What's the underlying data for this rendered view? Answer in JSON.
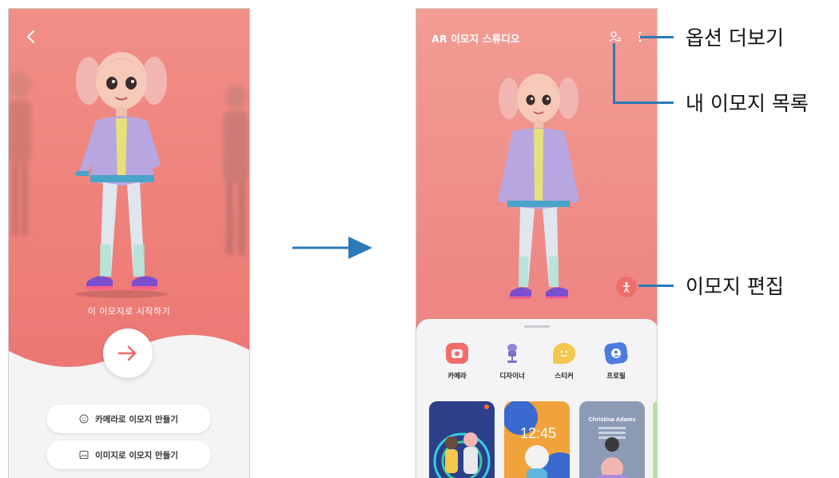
{
  "left_screen": {
    "back_icon": "chevron-left-icon",
    "start_text": "이 이모지로 시작하기",
    "next_icon": "arrow-right-icon",
    "buttons": [
      {
        "label": "카메라로 이모지 만들기",
        "icon": "face-icon"
      },
      {
        "label": "이미지로 이모지 만들기",
        "icon": "image-icon"
      }
    ]
  },
  "right_screen": {
    "title": "AR 이모지 스튜디오",
    "header_icons": [
      "my-emoji-list-icon",
      "more-options-icon"
    ],
    "edit_icon": "person-edit-icon",
    "menu": [
      {
        "label": "카메라",
        "icon": "camera-icon"
      },
      {
        "label": "디자이너",
        "icon": "designer-icon"
      },
      {
        "label": "스티커",
        "icon": "sticker-icon"
      },
      {
        "label": "프로필",
        "icon": "profile-icon"
      }
    ],
    "cards": [
      {
        "text": ""
      },
      {
        "text": "12:45"
      },
      {
        "text": "Christina Adams"
      }
    ]
  },
  "annotations": {
    "more_options": "옵션 더보기",
    "my_emoji_list": "내 이모지 목록",
    "edit_emoji": "이모지 편집"
  },
  "colors": {
    "accent_coral": "#ee7e78",
    "callout_line": "#2a7ab8",
    "flow_arrow": "#2a7ab8"
  }
}
